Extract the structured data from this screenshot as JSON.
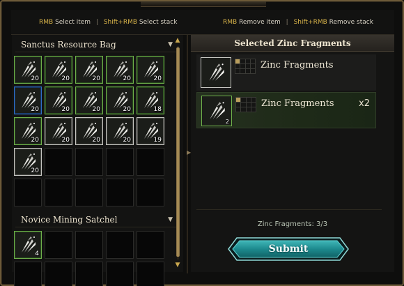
{
  "hints": {
    "select_key": "RMB",
    "select_text": "Select item",
    "select_stack_key": "Shift+RMB",
    "select_stack_text": "Select stack",
    "remove_key": "RMB",
    "remove_text": "Remove item",
    "remove_stack_key": "Shift+RMB",
    "remove_stack_text": "Remove stack",
    "separator": "|"
  },
  "bags": [
    {
      "title": "Sanctus Resource Bag",
      "caret": "▼",
      "slots": [
        {
          "item": "zinc-fragment",
          "rarity": "green",
          "qty": "20"
        },
        {
          "item": "zinc-fragment",
          "rarity": "green",
          "qty": "20"
        },
        {
          "item": "zinc-fragment",
          "rarity": "green",
          "qty": "20"
        },
        {
          "item": "zinc-fragment",
          "rarity": "green",
          "qty": "20"
        },
        {
          "item": "zinc-fragment",
          "rarity": "green",
          "qty": "20"
        },
        {
          "item": "zinc-fragment",
          "rarity": "blue",
          "qty": "20"
        },
        {
          "item": "zinc-fragment",
          "rarity": "green",
          "qty": "20"
        },
        {
          "item": "zinc-fragment",
          "rarity": "green",
          "qty": "20"
        },
        {
          "item": "zinc-fragment",
          "rarity": "green",
          "qty": "20"
        },
        {
          "item": "zinc-fragment",
          "rarity": "green",
          "qty": "18"
        },
        {
          "item": "zinc-fragment",
          "rarity": "green",
          "qty": "20"
        },
        {
          "item": "zinc-fragment",
          "rarity": "gray",
          "qty": "20"
        },
        {
          "item": "zinc-fragment",
          "rarity": "gray",
          "qty": "20"
        },
        {
          "item": "zinc-fragment",
          "rarity": "gray",
          "qty": "20"
        },
        {
          "item": "zinc-fragment",
          "rarity": "gray",
          "qty": "19"
        },
        {
          "item": "zinc-fragment",
          "rarity": "gray",
          "qty": "20"
        },
        {},
        {},
        {},
        {},
        {},
        {},
        {},
        {},
        {}
      ]
    },
    {
      "title": "Novice Mining Satchel",
      "caret": "▼",
      "slots": [
        {
          "item": "zinc-fragment",
          "rarity": "green",
          "qty": "4"
        },
        {},
        {},
        {},
        {},
        {},
        {},
        {},
        {},
        {}
      ]
    }
  ],
  "scroll": {
    "up": "▲",
    "down": "▼"
  },
  "side_arrow": "▶",
  "selected": {
    "title": "Selected Zinc Fragments",
    "rows": [
      {
        "name": "Zinc Fragments",
        "rarity": "gray",
        "icon_qty": "",
        "multiplier": "",
        "active": false
      },
      {
        "name": "Zinc Fragments",
        "rarity": "green",
        "icon_qty": "2",
        "multiplier": "x2",
        "active": true
      }
    ],
    "progress_text": "Zinc Fragments: 3/3",
    "submit_label": "Submit"
  },
  "colors": {
    "green": "#6fb04b",
    "gray": "#c7c7c2",
    "blue": "#2f6fc7",
    "accent_gold": "#d9b44a",
    "submit_teal": "#1f8d91"
  },
  "icons": {
    "item": "zinc-fragment-icon",
    "grid": "slot-grid-icon"
  }
}
